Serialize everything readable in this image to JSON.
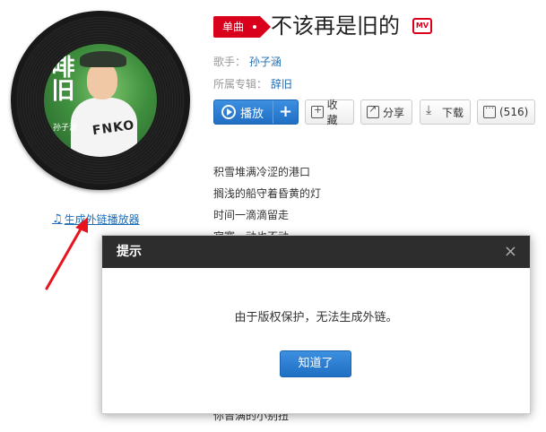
{
  "album_cover": {
    "title_text": "啡旧",
    "artist_text": "孙子涵",
    "shirt_text": "FNKO"
  },
  "ext_player_link": {
    "label": "生成外链播放器"
  },
  "song": {
    "badge": "单曲",
    "title": "不该再是旧的",
    "mv_label": "MV"
  },
  "meta": {
    "singer_label": "歌手：",
    "singer_value": "孙子涵",
    "album_label": "所属专辑：",
    "album_value": "辞旧"
  },
  "actions": {
    "play_label": "播放",
    "add_label": "+",
    "collect_label": "收藏",
    "share_label": "分享",
    "download_label": "下载",
    "comment_label": "(516)"
  },
  "lyrics": [
    "积雪堆满冷涩的港口",
    "搁浅的船守着昏黄的灯",
    "时间一滴滴留走",
    "寂寞一动也不动"
  ],
  "lyric_bottom": "你曾满的小别扭",
  "modal": {
    "title": "提示",
    "close": "×",
    "message": "由于版权保护，无法生成外链。",
    "ok_label": "知道了"
  }
}
